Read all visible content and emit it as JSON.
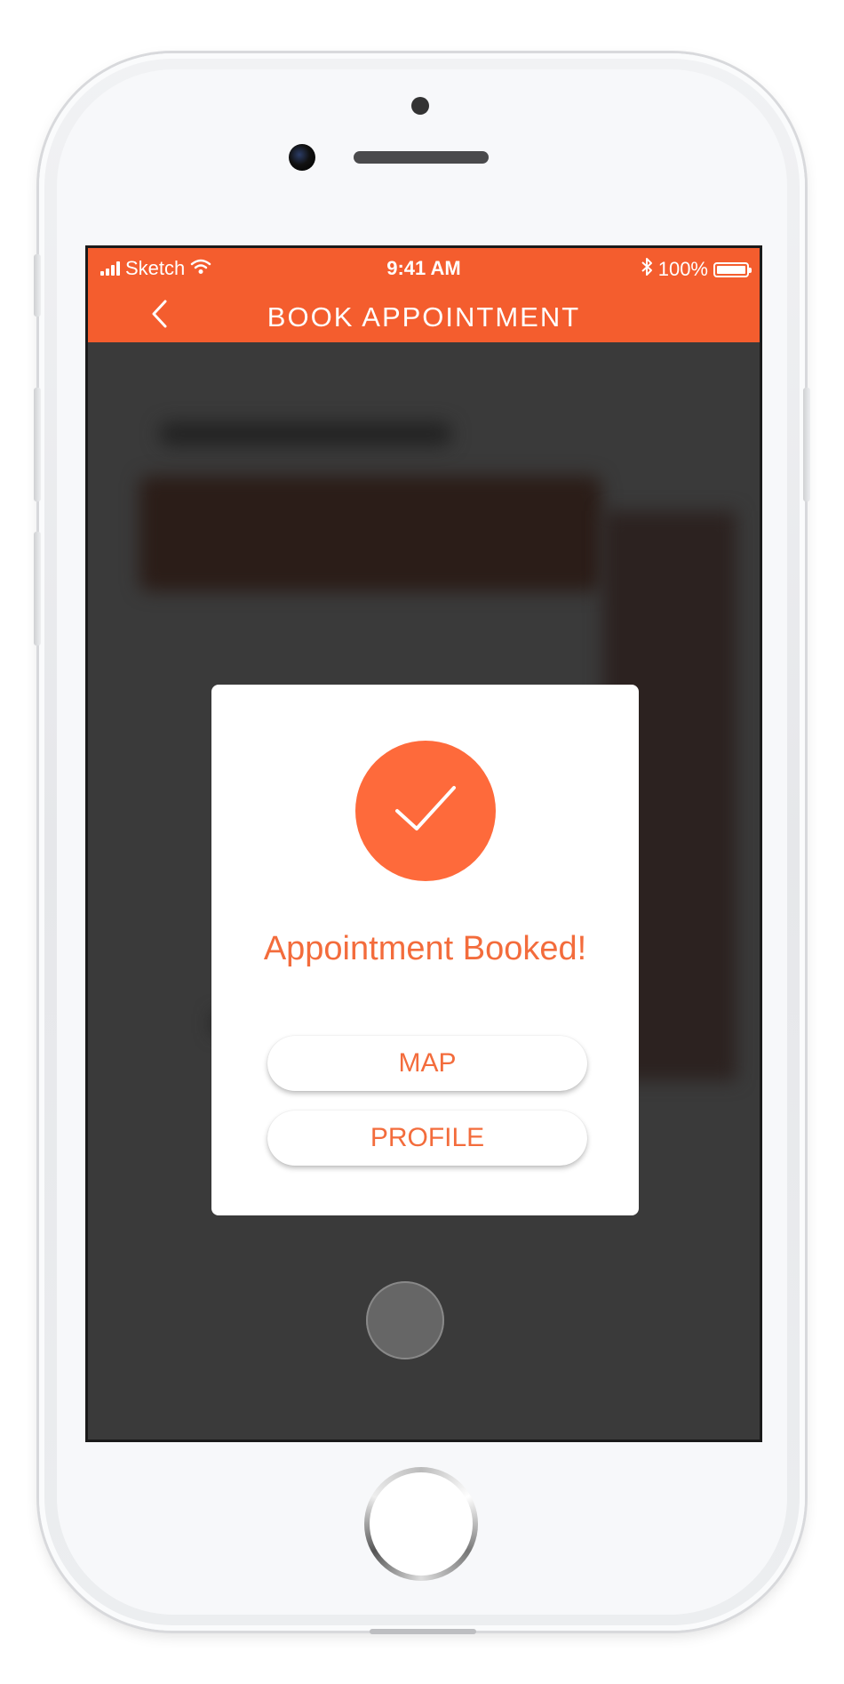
{
  "status_bar": {
    "carrier": "Sketch",
    "time": "9:41 AM",
    "battery": "100%",
    "icons": [
      "signal-icon",
      "wifi-icon",
      "bluetooth-icon",
      "battery-icon"
    ]
  },
  "nav": {
    "title": "BOOK APPOINTMENT",
    "back_icon": "chevron-left-icon"
  },
  "modal": {
    "icon": "checkmark-icon",
    "title": "Appointment Booked!",
    "buttons": [
      {
        "label": "MAP"
      },
      {
        "label": "PROFILE"
      }
    ]
  },
  "colors": {
    "accent": "#f45d2e",
    "check_circle": "#fe6a3b",
    "accent_text": "#f36c3c",
    "overlay": "#3a3a3a"
  }
}
